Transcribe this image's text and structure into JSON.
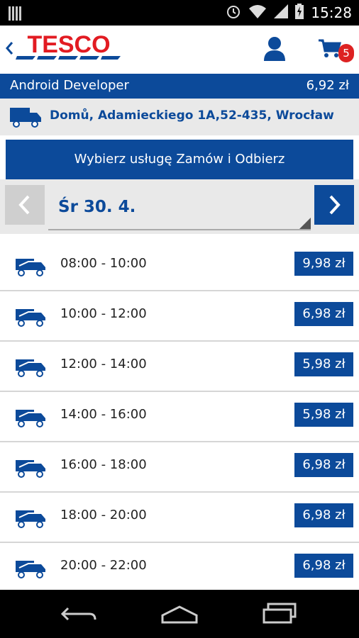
{
  "status_bar": {
    "time": "15:28"
  },
  "app_bar": {
    "logo_text": "TESCO",
    "cart_count": "5"
  },
  "user": {
    "name": "Android Developer",
    "balance": "6,92 zł"
  },
  "address": {
    "text": "Domů, Adamieckiego 1A,52-435, Wrocław"
  },
  "service": {
    "label": "Wybierz usługę Zamów i Odbierz"
  },
  "date": {
    "selected": "Śr 30. 4."
  },
  "slots": [
    {
      "time": "08:00 - 10:00",
      "price": "9,98 zł"
    },
    {
      "time": "10:00 - 12:00",
      "price": "6,98 zł"
    },
    {
      "time": "12:00 - 14:00",
      "price": "5,98 zł"
    },
    {
      "time": "14:00 - 16:00",
      "price": "5,98 zł"
    },
    {
      "time": "16:00 - 18:00",
      "price": "6,98 zł"
    },
    {
      "time": "18:00 - 20:00",
      "price": "6,98 zł"
    },
    {
      "time": "20:00 - 22:00",
      "price": "6,98 zł"
    }
  ],
  "colors": {
    "brand_blue": "#0c4a9a",
    "tesco_red": "#e21b22",
    "badge_red": "#d22222"
  }
}
